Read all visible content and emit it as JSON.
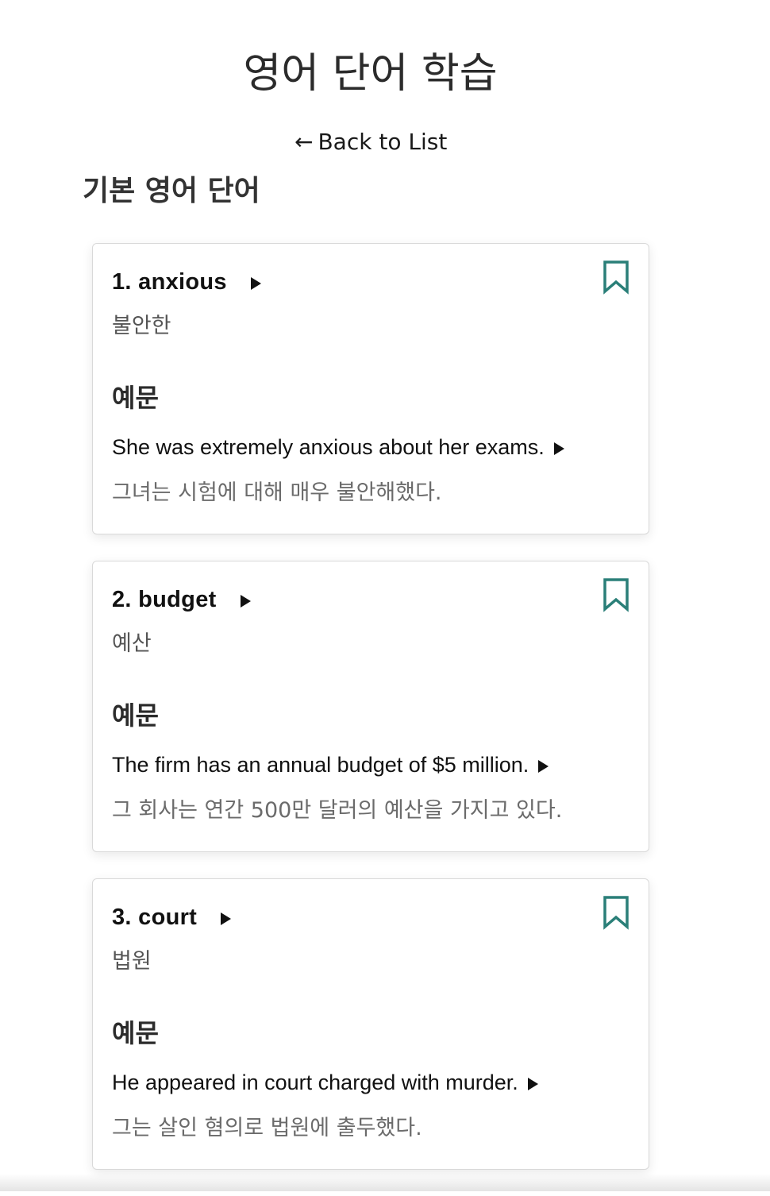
{
  "header": {
    "title": "영어 단어 학습",
    "back_arrow": "←",
    "back_label": "Back to List"
  },
  "section": {
    "title": "기본 영어 단어"
  },
  "colors": {
    "accent": "#2a7f78"
  },
  "icons": {
    "play": "play-icon",
    "bookmark": "bookmark-icon"
  },
  "words": [
    {
      "word": "1. anxious",
      "meaning": "불안한",
      "example_heading": "예문",
      "example_en": "She was extremely anxious about her exams.",
      "example_ko": "그녀는 시험에 대해 매우 불안해했다."
    },
    {
      "word": "2. budget",
      "meaning": "예산",
      "example_heading": "예문",
      "example_en": "The firm has an annual budget of $5 million.",
      "example_ko": "그 회사는 연간 500만 달러의 예산을 가지고 있다."
    },
    {
      "word": "3. court",
      "meaning": "법원",
      "example_heading": "예문",
      "example_en": "He appeared in court charged with murder.",
      "example_ko": "그는 살인 혐의로 법원에 출두했다."
    }
  ]
}
